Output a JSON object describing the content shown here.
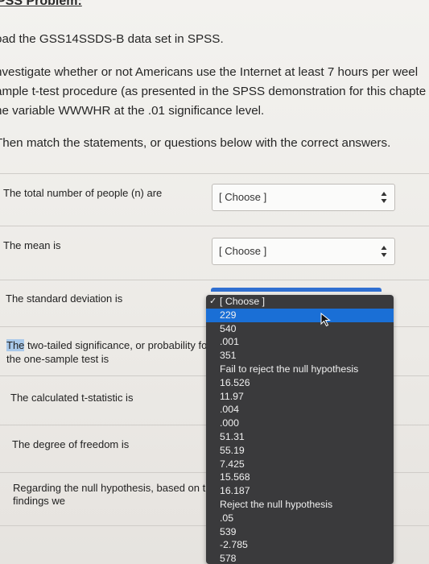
{
  "heading": "PSS Problem:",
  "paragraphs": [
    "oad the GSS14SSDS-B data set in SPSS.",
    "nvestigate whether or not Americans use the Internet at least 7 hours per weel",
    "ample t-test procedure (as presented in the SPSS demonstration for this chapte",
    "he variable WWWHR at the .01 significance level.",
    "Then match the statements, or questions below with the correct answers."
  ],
  "questions": [
    {
      "label": "The total number of people (n) are",
      "selected": "[ Choose ]"
    },
    {
      "label": "The mean is",
      "selected": "[ Choose ]"
    },
    {
      "label": "The standard deviation is"
    },
    {
      "label_highlight": "The",
      "label_rest": " two-tailed significance, or probability fo",
      "label_line2": "the one-sample test is"
    },
    {
      "label": "The calculated t-statistic is"
    },
    {
      "label": "The degree of freedom is"
    },
    {
      "label": "Regarding the null hypothesis, based on thes",
      "label_line2": "findings we"
    }
  ],
  "dropdown": {
    "items": [
      "[ Choose ]",
      "229",
      "540",
      ".001",
      "351",
      "Fail to reject the null hypothesis",
      "16.526",
      "11.97",
      ".004",
      ".000",
      "51.31",
      "55.19",
      "7.425",
      "15.568",
      "16.187",
      "Reject the null hypothesis",
      ".05",
      "539",
      "-2.785",
      "578"
    ],
    "checked_index": 0,
    "highlighted_index": 1
  },
  "icons": {
    "check": "checkmark-icon",
    "arrows": "up-down-arrows-icon",
    "cursor": "mouse-pointer-icon"
  },
  "colors": {
    "highlight": "#1a6fd6",
    "dropdown_bg": "#3a3a3c"
  }
}
